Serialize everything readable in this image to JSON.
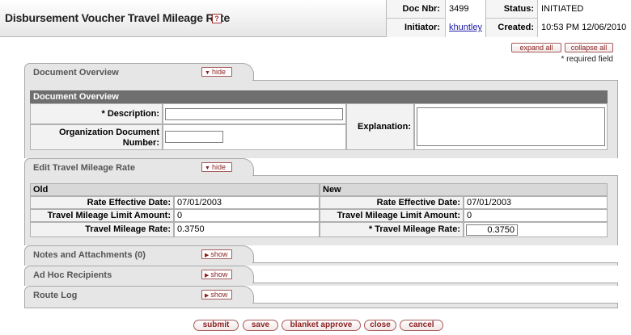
{
  "header": {
    "title": "Disbursement Voucher Travel Mileage Rate",
    "help_icon": "?",
    "doc_nbr_label": "Doc Nbr:",
    "doc_nbr": "3499",
    "status_label": "Status:",
    "status": "INITIATED",
    "initiator_label": "Initiator:",
    "initiator": "khuntley",
    "created_label": "Created:",
    "created": "10:53 PM 12/06/2010"
  },
  "toolbar": {
    "expand_all": "expand all",
    "collapse_all": "collapse all",
    "required_note": "* required field"
  },
  "tabs": {
    "document_overview": {
      "title": "Document Overview",
      "toggle": "hide"
    },
    "edit_travel_mileage_rate": {
      "title": "Edit Travel Mileage Rate",
      "toggle": "hide"
    },
    "notes_attachments": {
      "title": "Notes and Attachments (0)",
      "toggle": "show"
    },
    "ad_hoc_recipients": {
      "title": "Ad Hoc Recipients",
      "toggle": "show"
    },
    "route_log": {
      "title": "Route Log",
      "toggle": "show"
    }
  },
  "document_overview": {
    "section_title": "Document Overview",
    "description_label": "* Description:",
    "description_value": "",
    "org_doc_number_label": "Organization Document Number:",
    "org_doc_number_value": "",
    "explanation_label": "Explanation:",
    "explanation_value": ""
  },
  "mileage": {
    "old_header": "Old",
    "new_header": "New",
    "old": {
      "rate_effective_date_label": "Rate Effective Date:",
      "rate_effective_date": "07/01/2003",
      "limit_amount_label": "Travel Mileage Limit Amount:",
      "limit_amount": "0",
      "rate_label": "Travel Mileage Rate:",
      "rate": "0.3750"
    },
    "new": {
      "rate_effective_date_label": "Rate Effective Date:",
      "rate_effective_date": "07/01/2003",
      "limit_amount_label": "Travel Mileage Limit Amount:",
      "limit_amount": "0",
      "rate_label": "* Travel Mileage Rate:",
      "rate": "0.3750"
    }
  },
  "actions": {
    "submit": "submit",
    "save": "save",
    "blanket_approve": "blanket approve",
    "close": "close",
    "cancel": "cancel"
  }
}
